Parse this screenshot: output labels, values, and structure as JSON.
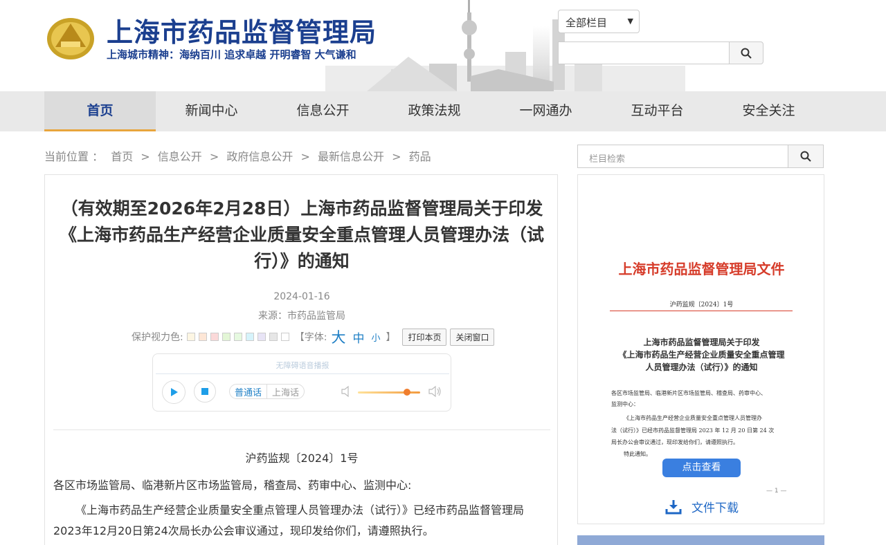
{
  "header": {
    "site_title": "上海市药品监督管理局",
    "slogan": "上海城市精神：海纳百川  追求卓越  开明睿智  大气谦和",
    "column_select": "全部栏目",
    "search_placeholder": ""
  },
  "nav": {
    "items": [
      "首页",
      "新闻中心",
      "信息公开",
      "政策法规",
      "一网通办",
      "互动平台",
      "安全关注"
    ],
    "active_index": 0
  },
  "breadcrumb": {
    "label": "当前位置 ：",
    "items": [
      "首页",
      "信息公开",
      "政府信息公开",
      "最新信息公开",
      "药品"
    ]
  },
  "article": {
    "title": "（有效期至2026年2月28日）上海市药品监督管理局关于印发《上海市药品生产经营企业质量安全重点管理人员管理办法（试行）》的通知",
    "date": "2024-01-16",
    "source": "来源：市药品监管局",
    "eye_color_label": "保护视力色:",
    "font_label": "【字体:",
    "font_big": "大",
    "font_mid": "中",
    "font_small": "小",
    "font_close": "】",
    "print_btn": "打印本页",
    "close_btn": "关闭窗口",
    "player_caption": "无障碍语音播报",
    "lang_mandarin": "普通话",
    "lang_shanghai": "上海话",
    "doc_no": "沪药监规〔2024〕1号",
    "para1": "各区市场监管局、临港新片区市场监管局，稽查局、药审中心、监测中心:",
    "para2": "《上海市药品生产经营企业质量安全重点管理人员管理办法（试行）》已经市药品监督管理局2023年12月20日第24次局长办公会审议通过，现印发给你们，请遵照执行。"
  },
  "sidebar": {
    "search_placeholder": "栏目检索",
    "doc_header": "上海市药品监督管理局文件",
    "doc_number": "沪药监规〔2024〕1号",
    "doc_title_1": "上海市药品监督管理局关于印发",
    "doc_title_2": "《上海市药品生产经营企业质量安全重点管理",
    "doc_title_3": "人员管理办法（试行）》的通知",
    "doc_body_1": "各区市场监管局、临港新片区市场监管局、稽查局、药审中心、",
    "doc_body_2": "监测中心：",
    "doc_body_3": "《上海市药品生产经营企业质量安全重点管理人员管理办",
    "doc_body_4": "法（试行）》已经市药品监督管理局 2023 年 12 月 20 日第 24 次",
    "doc_body_5": "局长办公会审议通过，现印发给你们，请遵照执行。",
    "doc_body_6": "特此通知。",
    "view_btn": "点击查看",
    "page_mark": "— 1 —",
    "download_label": "文件下载"
  },
  "colors": {
    "brand_blue": "#1b3f8f",
    "accent_orange": "#e8a53c",
    "link_blue": "#1e7fc5",
    "doc_red": "#d63c2a",
    "eye_swatches": [
      "#fdf6e3",
      "#fde6d6",
      "#fbd9d9",
      "#e3f6d6",
      "#e6f9e0",
      "#d6f3fb",
      "#e8e4f6",
      "#e6e6e6",
      "#ffffff"
    ]
  }
}
